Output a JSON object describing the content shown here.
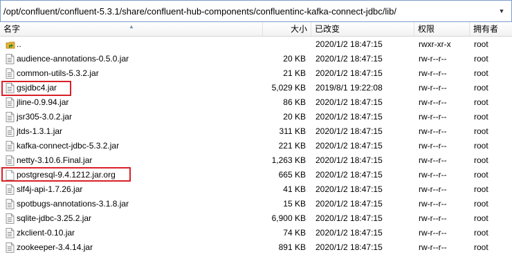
{
  "path": "/opt/confluent/confluent-5.3.1/share/confluent-hub-components/confluentinc-kafka-connect-jdbc/lib/",
  "columns": {
    "name": "名字",
    "size": "大小",
    "modified": "已改变",
    "perms": "权限",
    "owner": "拥有者"
  },
  "files": [
    {
      "name": "..",
      "size": "",
      "modified": "2020/1/2 18:47:15",
      "perms": "rwxr-xr-x",
      "owner": "root",
      "icon": "folder-up-icon"
    },
    {
      "name": "audience-annotations-0.5.0.jar",
      "size": "20 KB",
      "modified": "2020/1/2 18:47:15",
      "perms": "rw-r--r--",
      "owner": "root",
      "icon": "jar-file-icon"
    },
    {
      "name": "common-utils-5.3.2.jar",
      "size": "21 KB",
      "modified": "2020/1/2 18:47:15",
      "perms": "rw-r--r--",
      "owner": "root",
      "icon": "jar-file-icon"
    },
    {
      "name": "gsjdbc4.jar",
      "size": "5,029 KB",
      "modified": "2019/8/1 19:22:08",
      "perms": "rw-r--r--",
      "owner": "root",
      "icon": "jar-file-icon"
    },
    {
      "name": "jline-0.9.94.jar",
      "size": "86 KB",
      "modified": "2020/1/2 18:47:15",
      "perms": "rw-r--r--",
      "owner": "root",
      "icon": "jar-file-icon"
    },
    {
      "name": "jsr305-3.0.2.jar",
      "size": "20 KB",
      "modified": "2020/1/2 18:47:15",
      "perms": "rw-r--r--",
      "owner": "root",
      "icon": "jar-file-icon"
    },
    {
      "name": "jtds-1.3.1.jar",
      "size": "311 KB",
      "modified": "2020/1/2 18:47:15",
      "perms": "rw-r--r--",
      "owner": "root",
      "icon": "jar-file-icon"
    },
    {
      "name": "kafka-connect-jdbc-5.3.2.jar",
      "size": "221 KB",
      "modified": "2020/1/2 18:47:15",
      "perms": "rw-r--r--",
      "owner": "root",
      "icon": "jar-file-icon"
    },
    {
      "name": "netty-3.10.6.Final.jar",
      "size": "1,263 KB",
      "modified": "2020/1/2 18:47:15",
      "perms": "rw-r--r--",
      "owner": "root",
      "icon": "jar-file-icon"
    },
    {
      "name": "postgresql-9.4.1212.jar.org",
      "size": "665 KB",
      "modified": "2020/1/2 18:47:15",
      "perms": "rw-r--r--",
      "owner": "root",
      "icon": "blank-file-icon"
    },
    {
      "name": "slf4j-api-1.7.26.jar",
      "size": "41 KB",
      "modified": "2020/1/2 18:47:15",
      "perms": "rw-r--r--",
      "owner": "root",
      "icon": "jar-file-icon"
    },
    {
      "name": "spotbugs-annotations-3.1.8.jar",
      "size": "15 KB",
      "modified": "2020/1/2 18:47:15",
      "perms": "rw-r--r--",
      "owner": "root",
      "icon": "jar-file-icon"
    },
    {
      "name": "sqlite-jdbc-3.25.2.jar",
      "size": "6,900 KB",
      "modified": "2020/1/2 18:47:15",
      "perms": "rw-r--r--",
      "owner": "root",
      "icon": "jar-file-icon"
    },
    {
      "name": "zkclient-0.10.jar",
      "size": "74 KB",
      "modified": "2020/1/2 18:47:15",
      "perms": "rw-r--r--",
      "owner": "root",
      "icon": "jar-file-icon"
    },
    {
      "name": "zookeeper-3.4.14.jar",
      "size": "891 KB",
      "modified": "2020/1/2 18:47:15",
      "perms": "rw-r--r--",
      "owner": "root",
      "icon": "jar-file-icon"
    }
  ],
  "highlighted_files": [
    "gsjdbc4.jar",
    "postgresql-9.4.1212.jar.org"
  ],
  "colors": {
    "highlight": "#d81f26",
    "path_border": "#7a9cc8",
    "folder": "#e8b23a"
  }
}
